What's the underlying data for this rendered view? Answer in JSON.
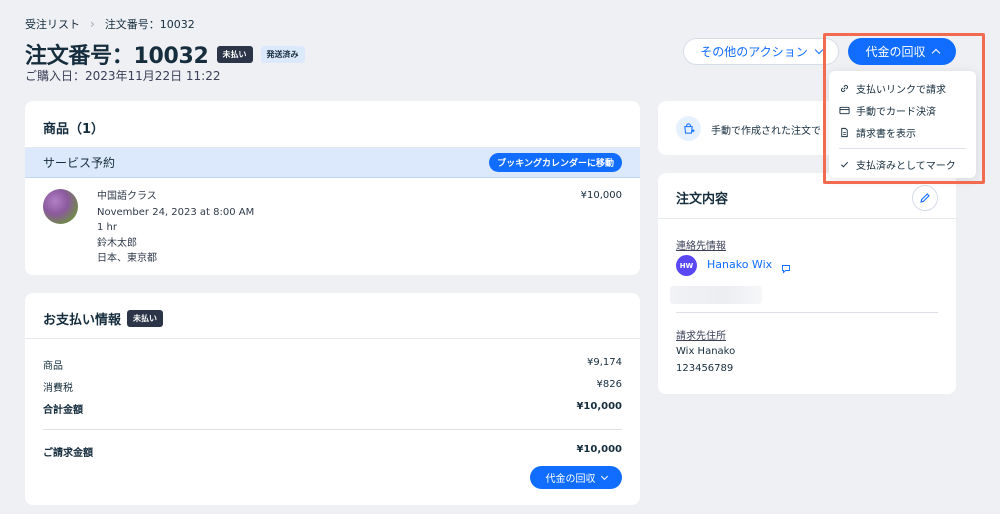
{
  "breadcrumb": {
    "root": "受注リスト",
    "current": "注文番号：10032"
  },
  "header": {
    "title": "注文番号：10032",
    "badge_unpaid": "未払い",
    "badge_shipped": "発送済み",
    "purchase_date": "ご購入日：2023年11月22日 11:22",
    "other_actions": "その他のアクション",
    "collect_payment": "代金の回収"
  },
  "products": {
    "title": "商品（1）",
    "service_label": "サービス予約",
    "calendar_button": "ブッキングカレンダーに移動",
    "item": {
      "name": "中国語クラス",
      "datetime": "November 24, 2023 at 8:00 AM",
      "duration": "1 hr",
      "staff": "鈴木太郎",
      "location": "日本、東京都",
      "price": "¥10,000"
    }
  },
  "payment": {
    "title": "お支払い情報",
    "badge": "未払い",
    "rows": [
      {
        "label": "商品",
        "value": "¥9,174"
      },
      {
        "label": "消費税",
        "value": "¥826"
      },
      {
        "label": "合計金額",
        "value": "¥10,000"
      }
    ],
    "due_label": "ご請求金額",
    "due_value": "¥10,000",
    "collect_button": "代金の回収"
  },
  "manual": {
    "text": "手動で作成された注文で"
  },
  "order_info": {
    "title": "注文内容",
    "contact_label": "連絡先情報",
    "avatar_initials": "HW",
    "contact_name": "Hanako Wix",
    "billing_label": "請求先住所",
    "billing_name": "Wix Hanako",
    "billing_number": "123456789"
  },
  "dropdown": {
    "items": [
      {
        "label": "支払いリンクで請求",
        "icon": "link-icon"
      },
      {
        "label": "手動でカード決済",
        "icon": "credit-card-icon"
      },
      {
        "label": "請求書を表示",
        "icon": "document-icon"
      }
    ],
    "mark_paid": "支払済みとしてマーク"
  },
  "colors": {
    "accent": "#116dff",
    "highlight": "#f26b50",
    "dark_badge": "#2b3547",
    "background": "#eff0f4"
  }
}
